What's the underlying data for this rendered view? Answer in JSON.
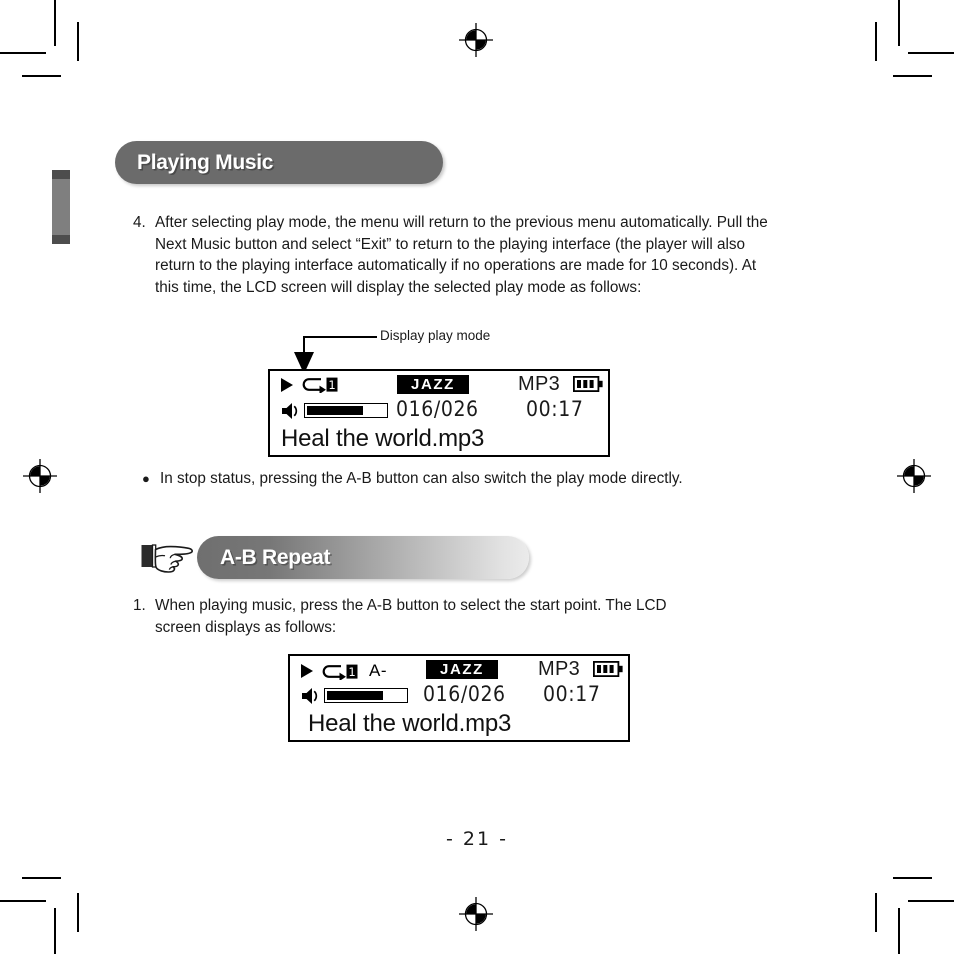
{
  "page": {
    "number_label": "- 21 -"
  },
  "sections": [
    {
      "id": "playing-music",
      "banner_title": "Playing Music"
    },
    {
      "id": "ab-repeat",
      "banner_title": "A-B Repeat",
      "icon": "pointing-hand-icon"
    }
  ],
  "content": {
    "step4": {
      "number": "4.",
      "text": "After selecting play mode, the menu will return to the previous menu automatically. Pull the Next Music button and select “Exit” to return to the playing interface (the player will also return to the playing interface automatically if no operations are made for 10 seconds). At this time, the LCD screen will display the selected play mode as follows:"
    },
    "bullet1": {
      "dot": "●",
      "text": "In stop status, pressing the A-B button can also switch the play mode directly."
    },
    "step1": {
      "number": "1.",
      "text": "When playing music, press the A-B button to select the start point. The LCD screen displays as follows:"
    }
  },
  "callout": {
    "label": "Display play mode"
  },
  "lcd_screen_1": {
    "play_icon": "play-triangle-icon",
    "repeat_icon": "repeat-one-icon",
    "repeat_badge": "1",
    "speaker_icon": "speaker-icon",
    "volume_percent": 72,
    "genre": "JAZZ",
    "track_counter": "016/026",
    "format": "MP3",
    "battery_icon": "battery-full-icon",
    "battery_bars": 3,
    "elapsed_time": "00:17",
    "song_title": "Heal the world.mp3",
    "ab_marker": ""
  },
  "lcd_screen_2": {
    "play_icon": "play-triangle-icon",
    "repeat_icon": "repeat-one-icon",
    "repeat_badge": "1",
    "speaker_icon": "speaker-icon",
    "volume_percent": 72,
    "genre": "JAZZ",
    "track_counter": "016/026",
    "format": "MP3",
    "battery_icon": "battery-full-icon",
    "battery_bars": 3,
    "elapsed_time": "00:17",
    "song_title": "Heal the world.mp3",
    "ab_marker": "A-"
  },
  "colors": {
    "banner_dark": "#6b6b6b",
    "banner_gradient_end": "#ebebeb",
    "text": "#1a1a1a",
    "lcd_border": "#000000",
    "side_tab": "#7f7f7f"
  }
}
